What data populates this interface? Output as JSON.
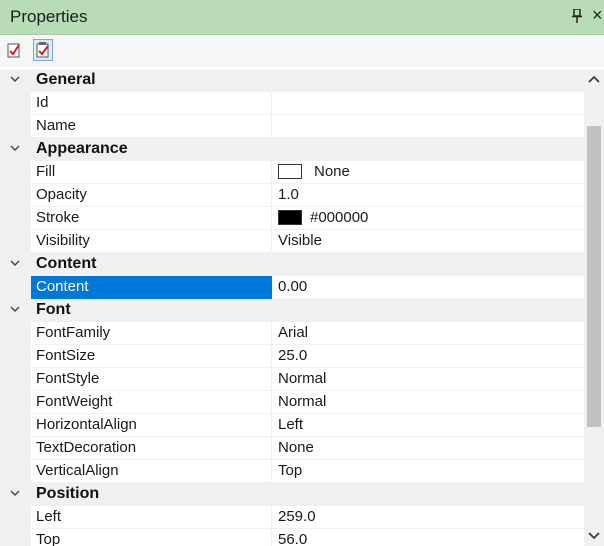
{
  "window": {
    "title": "Properties",
    "pin_icon": "pushpin-icon",
    "close_glyph": "×"
  },
  "toolbar": {
    "buttons": [
      {
        "icon": "categorized-view-icon",
        "active": false
      },
      {
        "icon": "alphabetical-view-icon",
        "active": true
      }
    ]
  },
  "colors": {
    "titlebar": "#b8dcb8",
    "selection": "#0078d7",
    "category_bg": "#f0f0f0",
    "stroke_swatch": "#000000",
    "fill_swatch": "#ffffff"
  },
  "grid": {
    "categories": {
      "general": "General",
      "appearance": "Appearance",
      "content": "Content",
      "font": "Font",
      "position": "Position"
    },
    "props": {
      "id": {
        "name": "Id",
        "value": ""
      },
      "name": {
        "name": "Name",
        "value": ""
      },
      "fill": {
        "name": "Fill",
        "value": "None"
      },
      "opacity": {
        "name": "Opacity",
        "value": "1.0"
      },
      "stroke": {
        "name": "Stroke",
        "value": "#000000"
      },
      "visibility": {
        "name": "Visibility",
        "value": "Visible"
      },
      "content": {
        "name": "Content",
        "value": "0.00"
      },
      "fontfamily": {
        "name": "FontFamily",
        "value": "Arial"
      },
      "fontsize": {
        "name": "FontSize",
        "value": "25.0"
      },
      "fontstyle": {
        "name": "FontStyle",
        "value": "Normal"
      },
      "fontweight": {
        "name": "FontWeight",
        "value": "Normal"
      },
      "horizontalalign": {
        "name": "HorizontalAlign",
        "value": "Left"
      },
      "textdecoration": {
        "name": "TextDecoration",
        "value": "None"
      },
      "verticalalign": {
        "name": "VerticalAlign",
        "value": "Top"
      },
      "left": {
        "name": "Left",
        "value": "259.0"
      },
      "top": {
        "name": "Top",
        "value": "56.0"
      }
    },
    "selected_property": "Content"
  },
  "scrollbar": {
    "position_fraction": 0.14
  }
}
